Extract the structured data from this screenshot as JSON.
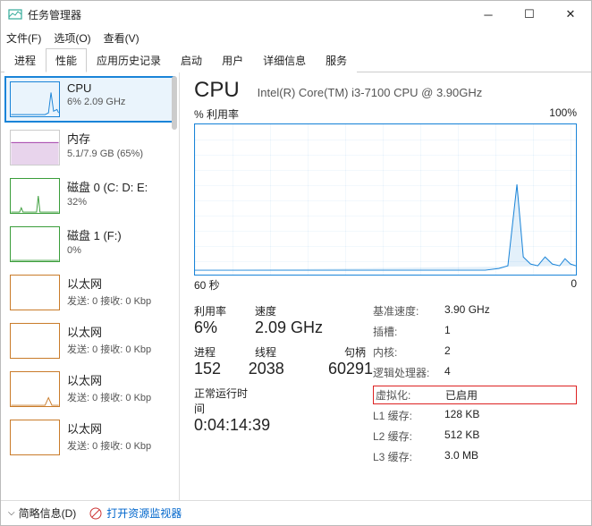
{
  "window": {
    "title": "任务管理器"
  },
  "menu": {
    "file": "文件(F)",
    "options": "选项(O)",
    "view": "查看(V)"
  },
  "tabs": {
    "t0": "进程",
    "t1": "性能",
    "t2": "应用历史记录",
    "t3": "启动",
    "t4": "用户",
    "t5": "详细信息",
    "t6": "服务"
  },
  "side": {
    "cpu": {
      "name": "CPU",
      "val": "6% 2.09 GHz"
    },
    "mem": {
      "name": "内存",
      "val": "5.1/7.9 GB (65%)"
    },
    "disk0": {
      "name": "磁盘 0 (C: D: E:",
      "val": "32%"
    },
    "disk1": {
      "name": "磁盘 1 (F:)",
      "val": "0%"
    },
    "eth0": {
      "name": "以太网",
      "val": "发送: 0 接收: 0 Kbp"
    },
    "eth1": {
      "name": "以太网",
      "val": "发送: 0 接收: 0 Kbp"
    },
    "eth2": {
      "name": "以太网",
      "val": "发送: 0 接收: 0 Kbp"
    },
    "eth3": {
      "name": "以太网",
      "val": "发送: 0 接收: 0 Kbp"
    }
  },
  "main": {
    "title": "CPU",
    "model": "Intel(R) Core(TM) i3-7100 CPU @ 3.90GHz",
    "ylabel": "% 利用率",
    "ymax": "100%",
    "xlabel_left": "60 秒",
    "xlabel_right": "0",
    "util_lbl": "利用率",
    "util": "6%",
    "speed_lbl": "速度",
    "speed": "2.09 GHz",
    "proc_lbl": "进程",
    "proc": "152",
    "thread_lbl": "线程",
    "thread": "2038",
    "handle_lbl": "句柄",
    "handle": "60291",
    "uptime_lbl": "正常运行时间",
    "uptime": "0:04:14:39",
    "base_lbl": "基准速度:",
    "base": "3.90 GHz",
    "socket_lbl": "插槽:",
    "socket": "1",
    "core_lbl": "内核:",
    "core": "2",
    "lp_lbl": "逻辑处理器:",
    "lp": "4",
    "virt_lbl": "虚拟化:",
    "virt": "已启用",
    "l1_lbl": "L1 缓存:",
    "l1": "128 KB",
    "l2_lbl": "L2 缓存:",
    "l2": "512 KB",
    "l3_lbl": "L3 缓存:",
    "l3": "3.0 MB"
  },
  "footer": {
    "less": "简略信息(D)",
    "rm": "打开资源监视器"
  },
  "chart_data": {
    "type": "line",
    "title": "% 利用率",
    "xlabel": "秒",
    "ylabel": "%",
    "ylim": [
      0,
      100
    ],
    "xlim": [
      60,
      0
    ],
    "values": [
      3,
      3,
      3,
      3,
      3,
      3,
      3,
      3,
      3,
      3,
      3,
      3,
      3,
      3,
      3,
      3,
      3,
      3,
      3,
      3,
      3,
      3,
      3,
      3,
      3,
      3,
      3,
      3,
      3,
      3,
      3,
      3,
      3,
      3,
      3,
      3,
      3,
      3,
      3,
      3,
      3,
      3,
      3,
      3,
      3,
      3,
      4,
      6,
      10,
      60,
      12,
      8,
      6,
      12,
      8,
      6,
      10,
      8,
      6,
      6
    ]
  }
}
